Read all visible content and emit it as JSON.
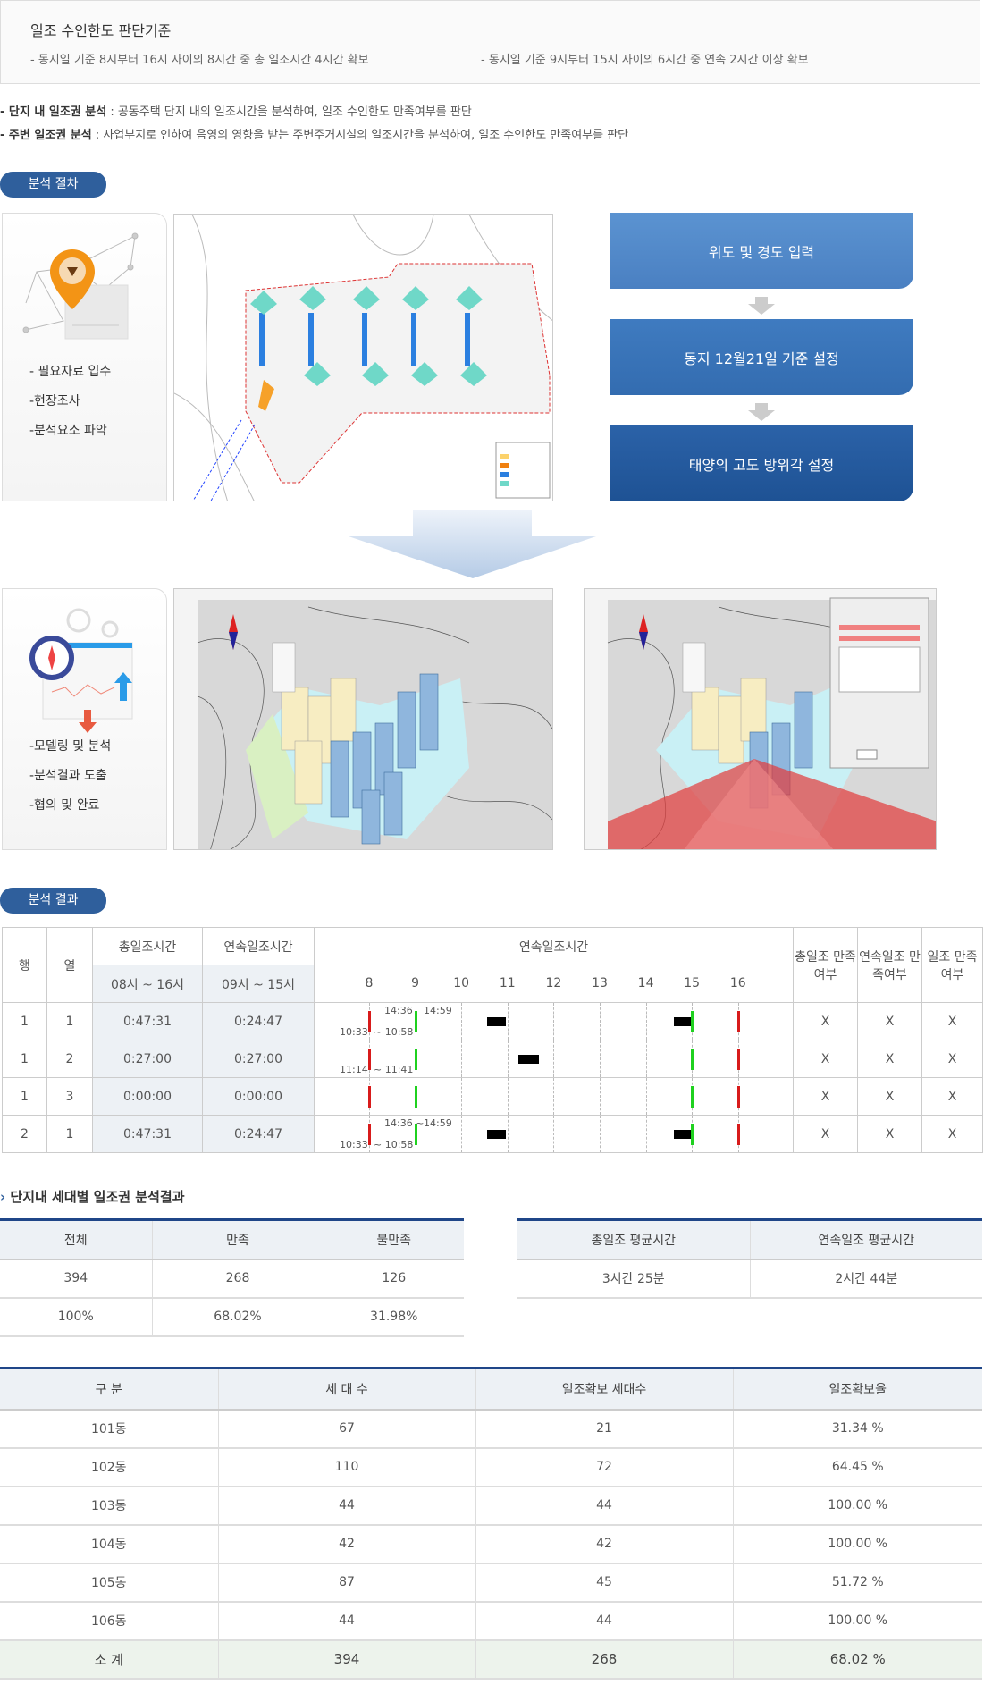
{
  "criteria": {
    "title": "일조 수인한도 판단기준",
    "items": [
      "- 동지일 기준 8시부터 16시 사이의 8시간 중 총 일조시간 4시간 확보",
      "- 동지일 기준 9시부터 15시 사이의 6시간 중 연속 2시간 이상 확보"
    ]
  },
  "analysis": [
    {
      "label": "- 단지 내 일조권 분석",
      "desc": " : 공동주택 단지 내의 일조시간을 분석하여, 일조 수인한도 만족여부를 판단"
    },
    {
      "label": "- 주변 일조권 분석",
      "desc": " : 사업부지로 인하여 음영의 영향을 받는 주변주거시설의 일조시간을 분석하여, 일조 수인한도 만족여부를 판단"
    }
  ],
  "procedure": {
    "badge": "분석 절차",
    "panel1": [
      "- 필요자료 입수",
      "-현장조사",
      "-분석요소 파악"
    ],
    "steps": [
      "위도 및 경도 입력",
      "동지 12월21일 기준 설정",
      "태양의 고도 방위각 설정"
    ],
    "panel2": [
      "-모델링 및 분석",
      "-분석결과 도출",
      "-협의 및 완료"
    ]
  },
  "result": {
    "badge": "분석 결과",
    "headers": {
      "row": "행",
      "col": "열",
      "total": "총일조시간",
      "cont": "연속일조시간",
      "timeline": "연속일조시간",
      "total_ok": "총일조 만족여부",
      "cont_ok": "연속일조 만족여부",
      "ok": "일조 만족여부",
      "total_range": "08시 ~ 16시",
      "cont_range": "09시 ~ 15시"
    },
    "hours": [
      "8",
      "9",
      "10",
      "11",
      "12",
      "13",
      "14",
      "15",
      "16"
    ],
    "rows": [
      {
        "row": "1",
        "col": "1",
        "total": "0:47:31",
        "cont": "0:24:47",
        "segments": [
          [
            10.55,
            10.97
          ],
          [
            14.6,
            14.98
          ]
        ],
        "labels": {
          "a": "10:33",
          "b": "~ 10:58",
          "c": "14:36",
          "d": "14:59"
        },
        "r1": "X",
        "r2": "X",
        "r3": "X"
      },
      {
        "row": "1",
        "col": "2",
        "total": "0:27:00",
        "cont": "0:27:00",
        "segments": [
          [
            11.23,
            11.68
          ]
        ],
        "labels": {
          "a": "11:14",
          "b": "~ 11:41"
        },
        "r1": "X",
        "r2": "X",
        "r3": "X"
      },
      {
        "row": "1",
        "col": "3",
        "total": "0:00:00",
        "cont": "0:00:00",
        "segments": [],
        "labels": {},
        "r1": "X",
        "r2": "X",
        "r3": "X"
      },
      {
        "row": "2",
        "col": "1",
        "total": "0:47:31",
        "cont": "0:24:47",
        "segments": [
          [
            10.55,
            10.97
          ],
          [
            14.6,
            14.98
          ]
        ],
        "labels": {
          "a": "10:33",
          "b": "~ 10:58",
          "c": "14:36 ~",
          "d": "14:59"
        },
        "r1": "X",
        "r2": "X",
        "r3": "X"
      }
    ]
  },
  "units": {
    "heading": "단지내 세대별 일조권 분석결과",
    "summary": {
      "headers": [
        "전체",
        "만족",
        "불만족"
      ],
      "rows": [
        [
          "394",
          "268",
          "126"
        ],
        [
          "100%",
          "68.02%",
          "31.98%"
        ]
      ]
    },
    "avg": {
      "headers": [
        "총일조 평균시간",
        "연속일조 평균시간"
      ],
      "values": [
        "3시간 25분",
        "2시간 44분"
      ]
    },
    "buildings": {
      "headers": [
        "구 분",
        "세 대 수",
        "일조확보 세대수",
        "일조확보율"
      ],
      "rows": [
        [
          "101동",
          "67",
          "21",
          "31.34 %"
        ],
        [
          "102동",
          "110",
          "72",
          "64.45 %"
        ],
        [
          "103동",
          "44",
          "44",
          "100.00 %"
        ],
        [
          "104동",
          "42",
          "42",
          "100.00 %"
        ],
        [
          "105동",
          "87",
          "45",
          "51.72 %"
        ],
        [
          "106동",
          "44",
          "44",
          "100.00 %"
        ]
      ],
      "total": [
        "소 계",
        "394",
        "268",
        "68.02  %"
      ]
    }
  },
  "colors": {
    "accent": "#2f5f9c",
    "navy": "#1f4688",
    "red": "#d81b1b",
    "green": "#1fd11f"
  }
}
